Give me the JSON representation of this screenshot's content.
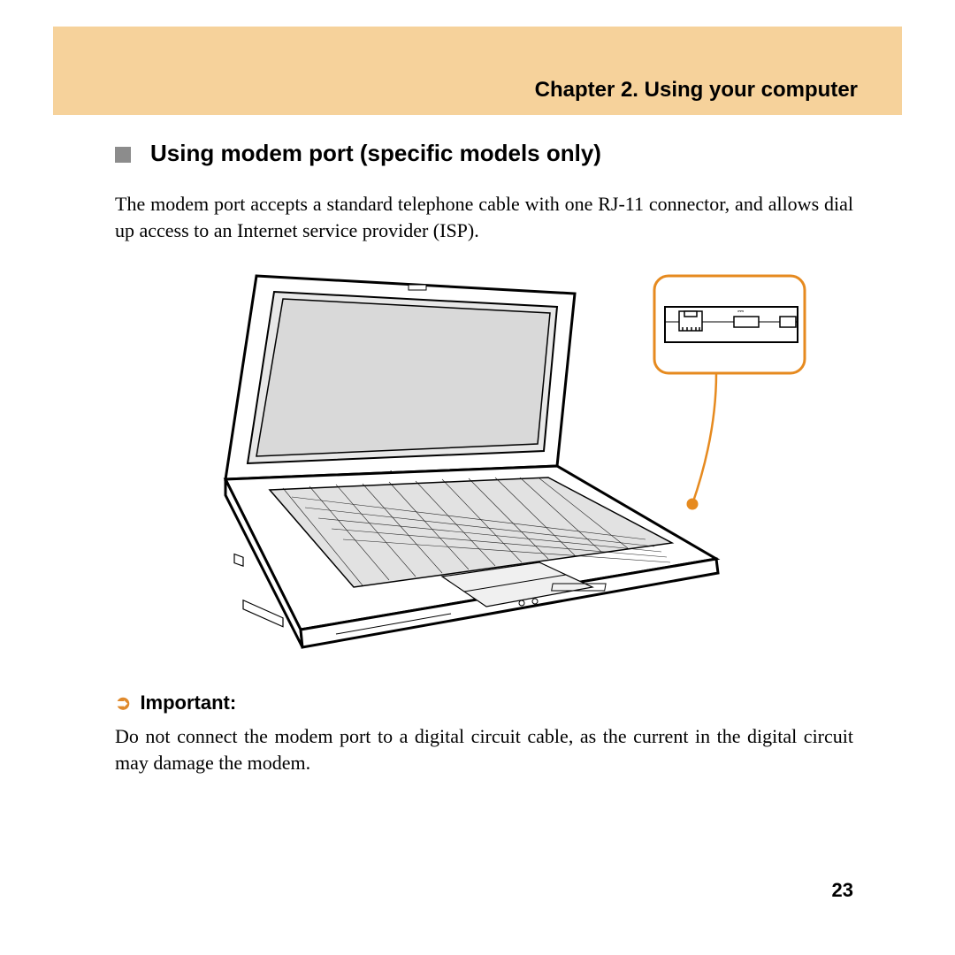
{
  "header": {
    "chapter": "Chapter 2. Using your computer"
  },
  "section": {
    "title": "Using modem port (specific models only)",
    "body": "The modem port accepts a standard telephone cable with one RJ-11 connector, and allows dial up access to an Internet service provider (ISP)."
  },
  "important": {
    "label": "Important:",
    "body": "Do not connect the modem port to a digital circuit cable, as the current in the digital circuit may damage the modem."
  },
  "page_number": "23",
  "figure": {
    "description": "Laptop line drawing with callout showing RJ-11 modem port on side panel",
    "callout_label": "modem-port-detail"
  }
}
